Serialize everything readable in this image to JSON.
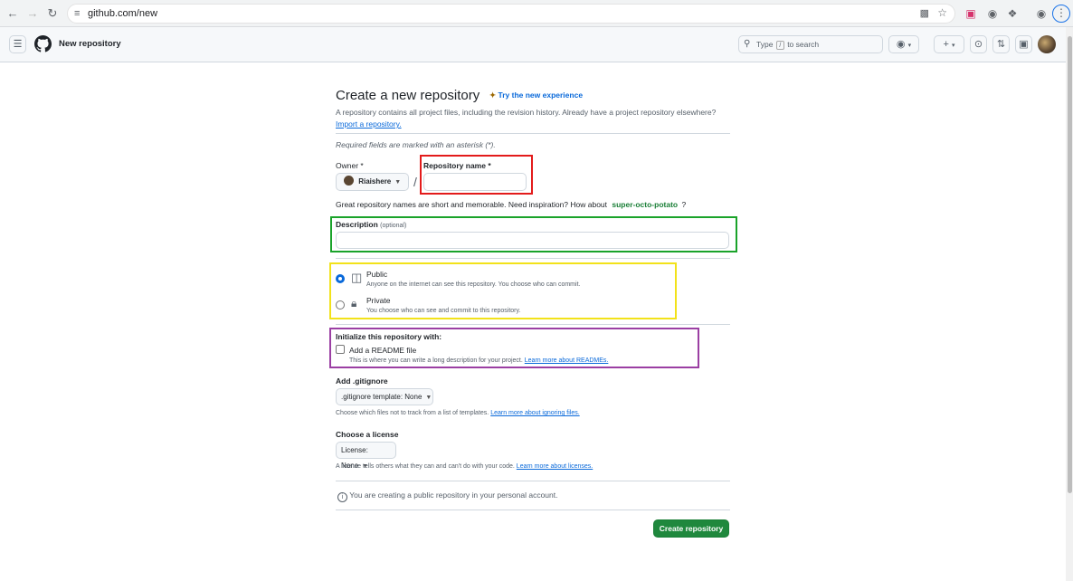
{
  "browser": {
    "url": "github.com/new"
  },
  "header": {
    "title": "New repository",
    "search_placeholder_pre": "Type",
    "search_slash": "/",
    "search_placeholder_post": "to search"
  },
  "page": {
    "heading": "Create a new repository",
    "try_link": "Try the new experience",
    "lead": "A repository contains all project files, including the revision history. Already have a project repository elsewhere?",
    "import_link": "Import a repository.",
    "required_note": "Required fields are marked with an asterisk (*).",
    "owner_label": "Owner *",
    "owner_value": "Riaishere",
    "slash": "/",
    "repo_name_label": "Repository name *",
    "repo_name_value": "",
    "inspiration_text": "Great repository names are short and memorable. Need inspiration? How about",
    "inspiration_name": "super-octo-potato",
    "inspiration_suffix": "?",
    "description_label": "Description",
    "description_optional": "(optional)",
    "description_value": "",
    "visibility": {
      "public_label": "Public",
      "public_desc": "Anyone on the internet can see this repository. You choose who can commit.",
      "private_label": "Private",
      "private_desc": "You choose who can see and commit to this repository.",
      "selected": "public"
    },
    "init_heading": "Initialize this repository with:",
    "readme_label": "Add a README file",
    "readme_desc": "This is where you can write a long description for your project.",
    "readme_link": "Learn more about READMEs.",
    "readme_checked": false,
    "gitignore_heading": "Add .gitignore",
    "gitignore_button": ".gitignore template: None",
    "gitignore_desc": "Choose which files not to track from a list of templates.",
    "gitignore_link": "Learn more about ignoring files.",
    "license_heading": "Choose a license",
    "license_button": "License: None",
    "license_desc": "A license tells others what they can and can't do with your code.",
    "license_link": "Learn more about licenses.",
    "info_text": "You are creating a public repository in your personal account.",
    "create_button": "Create repository"
  },
  "annotation_colors": {
    "repo_name_box": "#e31b1b",
    "description_box": "#1aa32a",
    "visibility_box": "#f2e21a",
    "init_box": "#9b3fa3"
  }
}
